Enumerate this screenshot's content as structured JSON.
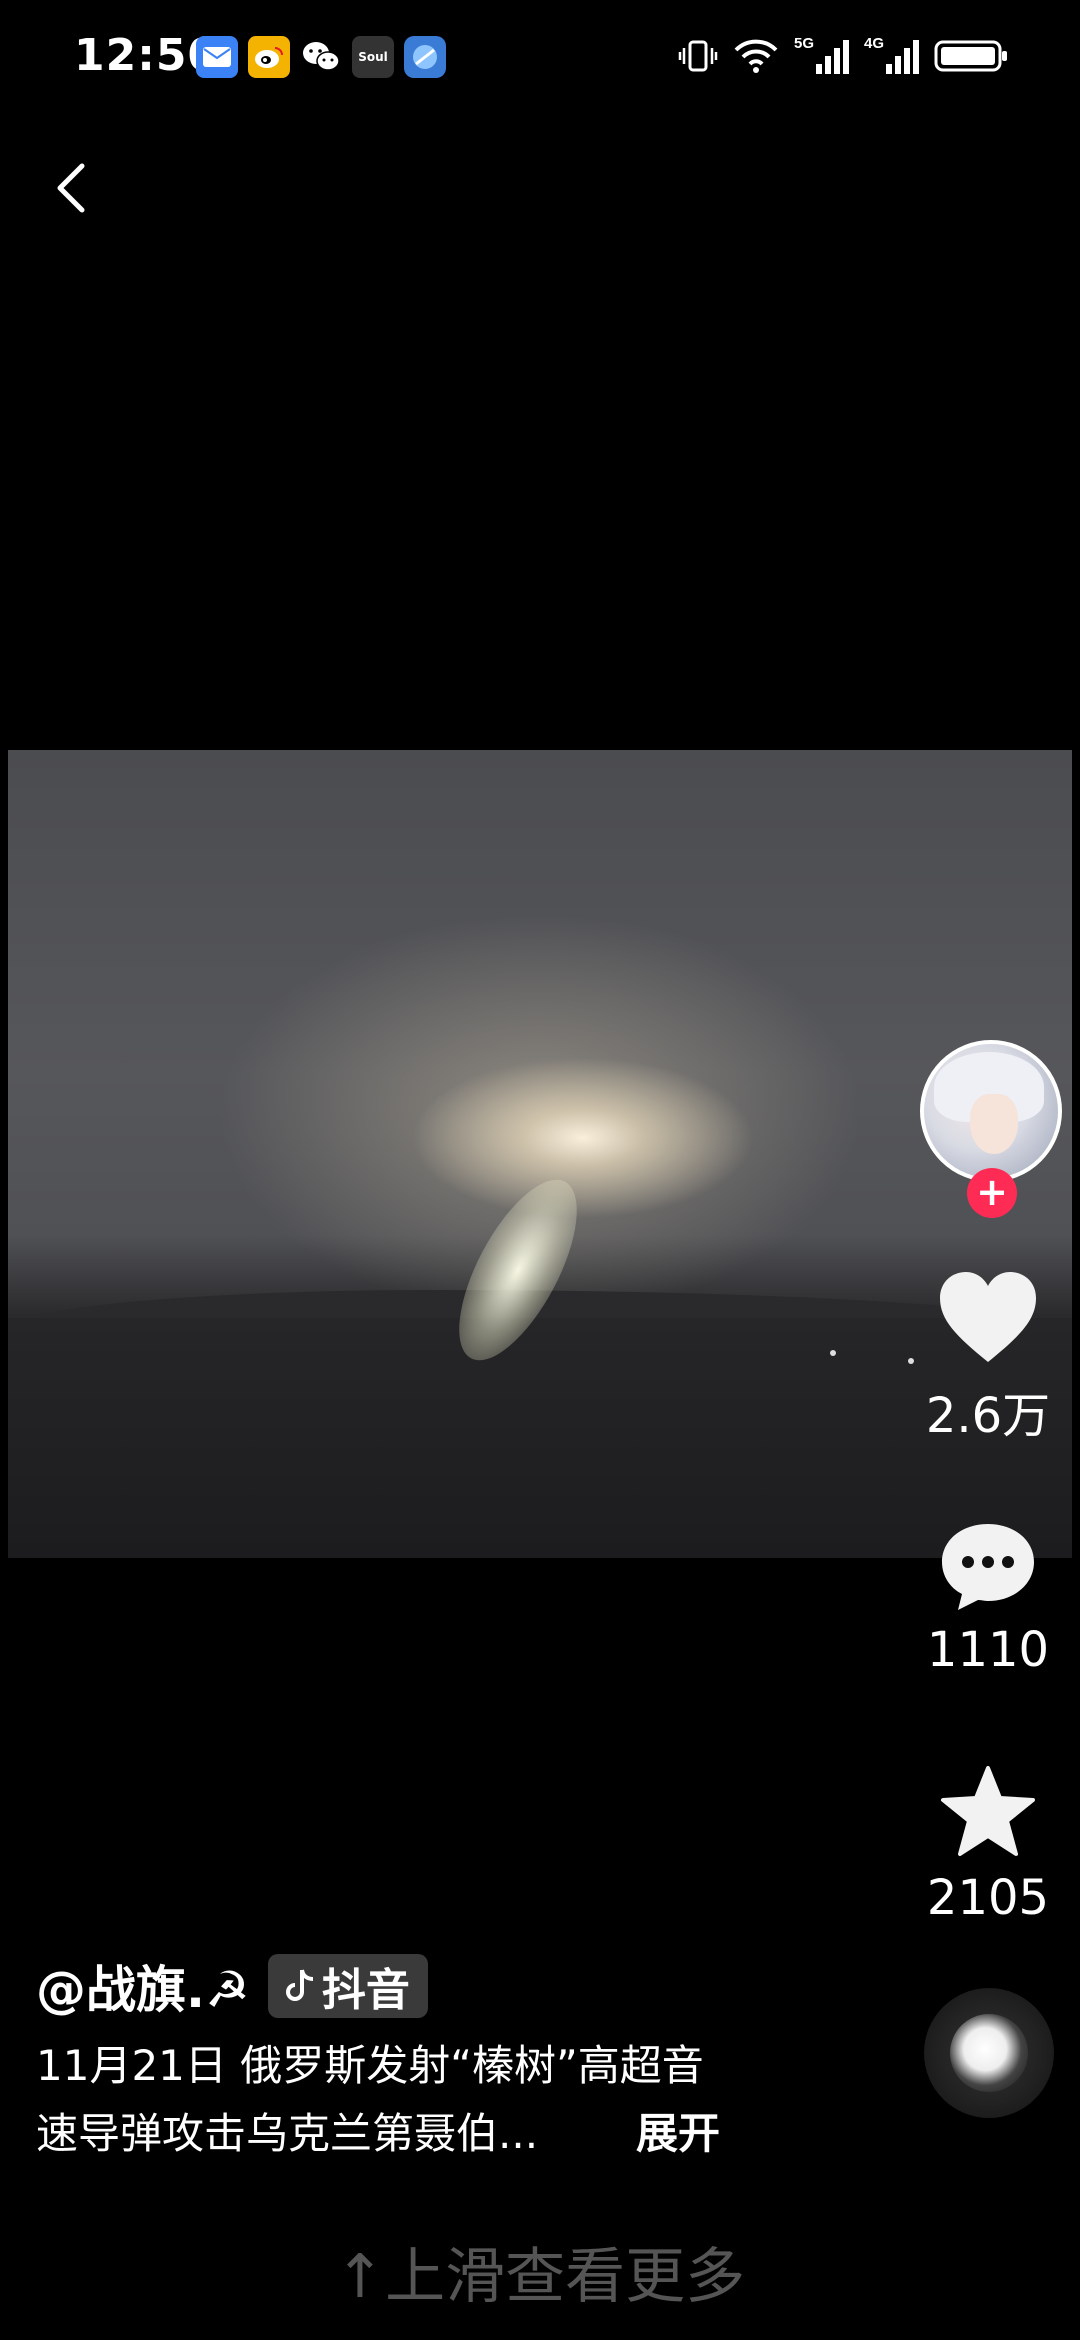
{
  "status_bar": {
    "time": "12:50",
    "notifications": [
      "mail-app-icon",
      "weibo-icon",
      "wechat-icon",
      "soul-app-icon",
      "browser-icon"
    ],
    "soul_label": "Soul",
    "network_5g": "5G",
    "network_4g": "4G"
  },
  "video": {
    "author": "@战旗.☭",
    "platform": "抖音",
    "caption_line1": "11月21日 俄罗斯发射“榛树”高超音",
    "caption_line2": "速导弹攻击乌克兰第聂伯...",
    "expand_label": "展开"
  },
  "actions": {
    "likes": "2.6万",
    "comments": "1110",
    "favorites": "2105"
  },
  "follow_plus": "+",
  "swipe_hint": "↑上滑查看更多",
  "colors": {
    "background": "#000000",
    "follow_badge": "#fe2c55",
    "hint_text": "#555555"
  }
}
